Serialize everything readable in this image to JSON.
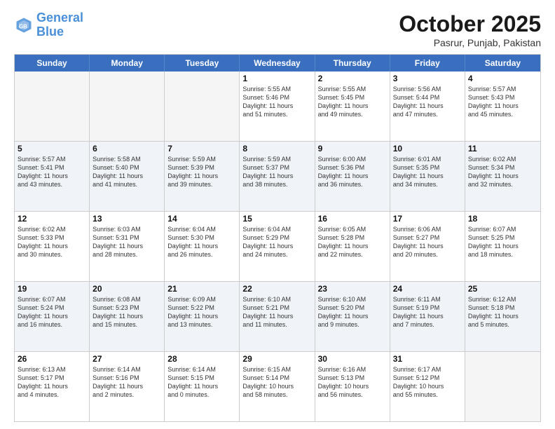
{
  "header": {
    "logo_general": "General",
    "logo_blue": "Blue",
    "month": "October 2025",
    "location": "Pasrur, Punjab, Pakistan"
  },
  "weekdays": [
    "Sunday",
    "Monday",
    "Tuesday",
    "Wednesday",
    "Thursday",
    "Friday",
    "Saturday"
  ],
  "rows": [
    [
      {
        "day": "",
        "info": "",
        "empty": true
      },
      {
        "day": "",
        "info": "",
        "empty": true
      },
      {
        "day": "",
        "info": "",
        "empty": true
      },
      {
        "day": "1",
        "info": "Sunrise: 5:55 AM\nSunset: 5:46 PM\nDaylight: 11 hours\nand 51 minutes."
      },
      {
        "day": "2",
        "info": "Sunrise: 5:55 AM\nSunset: 5:45 PM\nDaylight: 11 hours\nand 49 minutes."
      },
      {
        "day": "3",
        "info": "Sunrise: 5:56 AM\nSunset: 5:44 PM\nDaylight: 11 hours\nand 47 minutes."
      },
      {
        "day": "4",
        "info": "Sunrise: 5:57 AM\nSunset: 5:43 PM\nDaylight: 11 hours\nand 45 minutes."
      }
    ],
    [
      {
        "day": "5",
        "info": "Sunrise: 5:57 AM\nSunset: 5:41 PM\nDaylight: 11 hours\nand 43 minutes."
      },
      {
        "day": "6",
        "info": "Sunrise: 5:58 AM\nSunset: 5:40 PM\nDaylight: 11 hours\nand 41 minutes."
      },
      {
        "day": "7",
        "info": "Sunrise: 5:59 AM\nSunset: 5:39 PM\nDaylight: 11 hours\nand 39 minutes."
      },
      {
        "day": "8",
        "info": "Sunrise: 5:59 AM\nSunset: 5:37 PM\nDaylight: 11 hours\nand 38 minutes."
      },
      {
        "day": "9",
        "info": "Sunrise: 6:00 AM\nSunset: 5:36 PM\nDaylight: 11 hours\nand 36 minutes."
      },
      {
        "day": "10",
        "info": "Sunrise: 6:01 AM\nSunset: 5:35 PM\nDaylight: 11 hours\nand 34 minutes."
      },
      {
        "day": "11",
        "info": "Sunrise: 6:02 AM\nSunset: 5:34 PM\nDaylight: 11 hours\nand 32 minutes."
      }
    ],
    [
      {
        "day": "12",
        "info": "Sunrise: 6:02 AM\nSunset: 5:33 PM\nDaylight: 11 hours\nand 30 minutes."
      },
      {
        "day": "13",
        "info": "Sunrise: 6:03 AM\nSunset: 5:31 PM\nDaylight: 11 hours\nand 28 minutes."
      },
      {
        "day": "14",
        "info": "Sunrise: 6:04 AM\nSunset: 5:30 PM\nDaylight: 11 hours\nand 26 minutes."
      },
      {
        "day": "15",
        "info": "Sunrise: 6:04 AM\nSunset: 5:29 PM\nDaylight: 11 hours\nand 24 minutes."
      },
      {
        "day": "16",
        "info": "Sunrise: 6:05 AM\nSunset: 5:28 PM\nDaylight: 11 hours\nand 22 minutes."
      },
      {
        "day": "17",
        "info": "Sunrise: 6:06 AM\nSunset: 5:27 PM\nDaylight: 11 hours\nand 20 minutes."
      },
      {
        "day": "18",
        "info": "Sunrise: 6:07 AM\nSunset: 5:25 PM\nDaylight: 11 hours\nand 18 minutes."
      }
    ],
    [
      {
        "day": "19",
        "info": "Sunrise: 6:07 AM\nSunset: 5:24 PM\nDaylight: 11 hours\nand 16 minutes."
      },
      {
        "day": "20",
        "info": "Sunrise: 6:08 AM\nSunset: 5:23 PM\nDaylight: 11 hours\nand 15 minutes."
      },
      {
        "day": "21",
        "info": "Sunrise: 6:09 AM\nSunset: 5:22 PM\nDaylight: 11 hours\nand 13 minutes."
      },
      {
        "day": "22",
        "info": "Sunrise: 6:10 AM\nSunset: 5:21 PM\nDaylight: 11 hours\nand 11 minutes."
      },
      {
        "day": "23",
        "info": "Sunrise: 6:10 AM\nSunset: 5:20 PM\nDaylight: 11 hours\nand 9 minutes."
      },
      {
        "day": "24",
        "info": "Sunrise: 6:11 AM\nSunset: 5:19 PM\nDaylight: 11 hours\nand 7 minutes."
      },
      {
        "day": "25",
        "info": "Sunrise: 6:12 AM\nSunset: 5:18 PM\nDaylight: 11 hours\nand 5 minutes."
      }
    ],
    [
      {
        "day": "26",
        "info": "Sunrise: 6:13 AM\nSunset: 5:17 PM\nDaylight: 11 hours\nand 4 minutes."
      },
      {
        "day": "27",
        "info": "Sunrise: 6:14 AM\nSunset: 5:16 PM\nDaylight: 11 hours\nand 2 minutes."
      },
      {
        "day": "28",
        "info": "Sunrise: 6:14 AM\nSunset: 5:15 PM\nDaylight: 11 hours\nand 0 minutes."
      },
      {
        "day": "29",
        "info": "Sunrise: 6:15 AM\nSunset: 5:14 PM\nDaylight: 10 hours\nand 58 minutes."
      },
      {
        "day": "30",
        "info": "Sunrise: 6:16 AM\nSunset: 5:13 PM\nDaylight: 10 hours\nand 56 minutes."
      },
      {
        "day": "31",
        "info": "Sunrise: 6:17 AM\nSunset: 5:12 PM\nDaylight: 10 hours\nand 55 minutes."
      },
      {
        "day": "",
        "info": "",
        "empty": true
      }
    ]
  ]
}
